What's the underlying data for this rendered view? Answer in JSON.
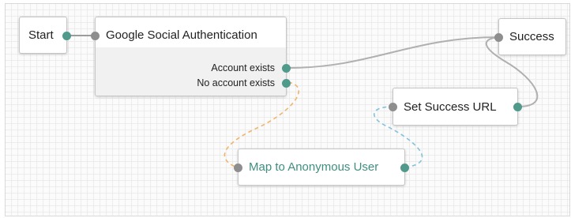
{
  "nodes": {
    "start": {
      "label": "Start"
    },
    "google": {
      "label": "Google Social Authentication",
      "outcomes": [
        "Account exists",
        "No account exists"
      ]
    },
    "success": {
      "label": "Success"
    },
    "set_success_url": {
      "label": "Set Success URL"
    },
    "map_anonymous": {
      "label": "Map to Anonymous User"
    }
  },
  "colors": {
    "input_port": "#8e8e8e",
    "output_port": "#4f9a8b",
    "connector": "#b0b0b0",
    "dashed_orange": "#f0b56b",
    "dashed_blue": "#7fc3dc",
    "node_title_green": "#3f8f7f"
  }
}
